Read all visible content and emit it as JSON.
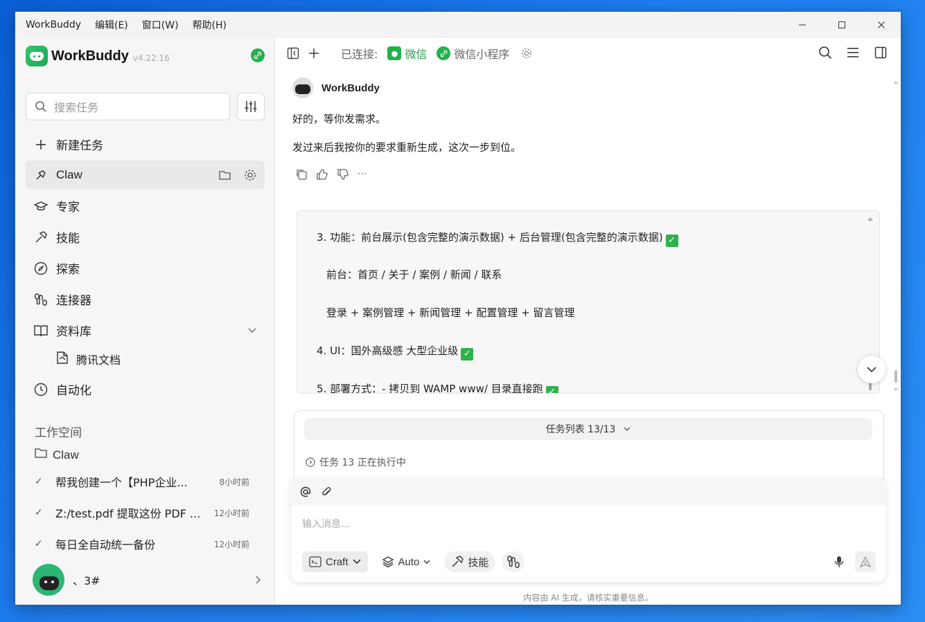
{
  "titlebar": {
    "app": "WorkBuddy",
    "menus": [
      "编辑(E)",
      "窗口(W)",
      "帮助(H)"
    ],
    "minimize": "—",
    "maximize": "☐",
    "close": "✕"
  },
  "sidebar": {
    "brand": "WorkBuddy",
    "version": "v4.22.16",
    "search_placeholder": "搜索任务",
    "nav": {
      "new_task": "新建任务",
      "claw": "Claw",
      "experts": "专家",
      "skills": "技能",
      "explore": "探索",
      "connectors": "连接器",
      "library": "资料库",
      "tencent_docs": "腾讯文档",
      "automation": "自动化"
    },
    "workspace_label": "工作空间",
    "workspace_item": "Claw",
    "tasks": [
      {
        "title": "帮我创建一个【PHP企业...",
        "time": "8小时前"
      },
      {
        "title": "Z:/test.pdf 提取这份 PDF ...",
        "time": "12小时前"
      },
      {
        "title": "每日全自动统一备份",
        "time": "12小时前"
      }
    ],
    "user_name": "、3#"
  },
  "toolbar": {
    "connected_label": "已连接:",
    "channel_wechat": "微信",
    "channel_miniprogram": "微信小程序"
  },
  "message": {
    "sender": "WorkBuddy",
    "line1": "好的，等你发需求。",
    "line2": "发过来后我按你的要求重新生成，这次一步到位。",
    "more": "···"
  },
  "code_block": {
    "l1": "3. 功能：前台展示(包含完整的演示数据) + 后台管理(包含完整的演示数据)",
    "l2": "前台：首页 / 关于 / 案例 / 新闻 / 联系",
    "l3": "登录 + 案例管理 + 新闻管理 + 配置管理 + 留言管理",
    "l4": "4. UI：国外高级感 大型企业级",
    "l5": "5. 部署方式：- 拷贝到 WAMP www/ 目录直接跑",
    "check": "✓"
  },
  "task_panel": {
    "header": "任务列表 13/13",
    "status": "任务 13 正在执行中"
  },
  "input": {
    "placeholder": "输入消息...",
    "mode": "Craft",
    "model": "Auto",
    "skills": "技能"
  },
  "disclaimer": "内容由 AI 生成，请核实重要信息。"
}
